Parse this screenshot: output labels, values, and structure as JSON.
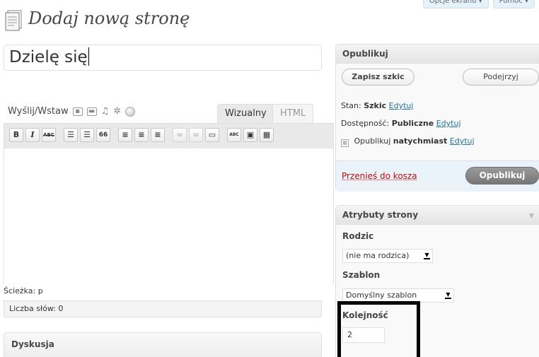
{
  "screen_options": {
    "options_label": "Opcje ekranu ▾",
    "help_label": "Pomoc ▾"
  },
  "page": {
    "title": "Dodaj nową stronę"
  },
  "editor": {
    "post_title": "Dzielę się",
    "upload_label": "Wyślij/Wstaw",
    "tab_visual": "Wizualny",
    "tab_html": "HTML",
    "path_label": "Ścieżka: p",
    "word_count_label": "Liczba słów: 0",
    "toolbar": {
      "bold": "B",
      "italic": "I",
      "strike": "ABC",
      "ul": "☰",
      "ol": "☰",
      "quote": "66",
      "align_left": "≡",
      "align_center": "≡",
      "align_right": "≡",
      "link": "∞",
      "unlink": "∞",
      "more": "▭",
      "spell": "ABC",
      "fullscreen": "▣",
      "kitchen": "▦"
    }
  },
  "discussion": {
    "title": "Dyskusja"
  },
  "publish": {
    "title": "Opublikuj",
    "save_draft_label": "Zapisz szkic",
    "preview_label": "Podejrzyj",
    "status_label": "Stan:",
    "status_value": "Szkic",
    "status_edit": "Edytuj",
    "visibility_label": "Dostępność:",
    "visibility_value": "Publiczne",
    "visibility_edit": "Edytuj",
    "schedule_label": "Opublikuj",
    "schedule_value": "natychmiast",
    "schedule_edit": "Edytuj",
    "trash_label": "Przenieś do kosza",
    "publish_label": "Opublikuj"
  },
  "attributes": {
    "title": "Atrybuty strony",
    "parent_label": "Rodzic",
    "parent_value": "(nie ma rodzica)",
    "template_label": "Szablon",
    "template_value": "Domyślny szablon",
    "order_label": "Kolejność",
    "order_value": "2",
    "toggle": "▼"
  }
}
